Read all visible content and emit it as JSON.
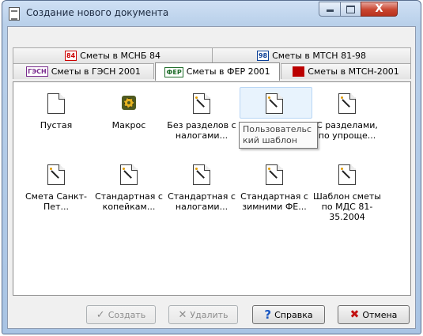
{
  "window": {
    "title": "Создание нового документа"
  },
  "titlebar_controls": {
    "close_symbol": "X"
  },
  "tabs": {
    "row_top": [
      {
        "icon_text": "84",
        "label": "Сметы в МСНБ 84"
      },
      {
        "icon_text": "98",
        "label": "Сметы в МТСН 81-98"
      }
    ],
    "row_bottom": [
      {
        "icon_text": "ГЭСН",
        "label": "Сметы в ГЭСН 2001"
      },
      {
        "icon_text": "ФЕР",
        "label": "Сметы в ФЕР 2001"
      },
      {
        "icon_text": "",
        "label": "Сметы в МТСН-2001"
      }
    ],
    "active_tab": "Сметы в ФЕР 2001"
  },
  "templates": [
    {
      "label": "Пустая",
      "icon": "blank-doc-icon"
    },
    {
      "label": "Макрос",
      "icon": "macro-gear-icon"
    },
    {
      "label": "Без разделов с налогами...",
      "icon": "template-wizard-icon"
    },
    {
      "label": "Пользовательский шаблон",
      "icon": "template-wizard-icon"
    },
    {
      "label": "С разделами, по упроще...",
      "icon": "template-wizard-icon"
    },
    {
      "label": "Смета Санкт-Пет...",
      "icon": "template-wizard-icon"
    },
    {
      "label": "Стандартная с копейкам...",
      "icon": "template-wizard-icon"
    },
    {
      "label": "Стандартная с налогами...",
      "icon": "template-wizard-icon"
    },
    {
      "label": "Стандартная с зимними ФЕ...",
      "icon": "template-wizard-icon"
    },
    {
      "label": "Шаблон сметы по МДС 81-35.2004",
      "icon": "template-wizard-icon"
    }
  ],
  "tooltip": {
    "text": "Пользовательский шаблон"
  },
  "buttons": {
    "create": "Создать",
    "delete": "Удалить",
    "help": "Справка",
    "cancel": "Отмена"
  }
}
